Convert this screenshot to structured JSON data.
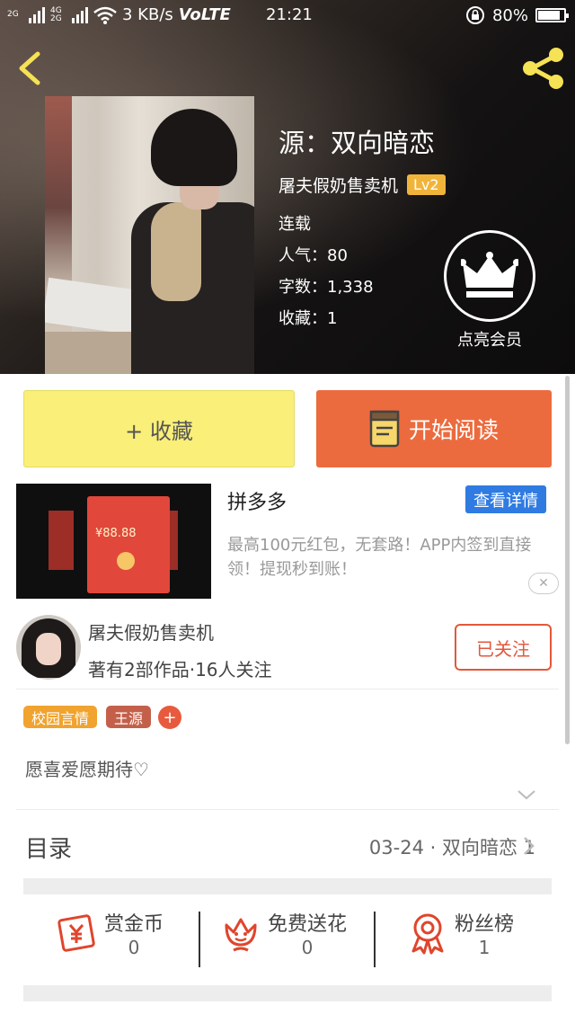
{
  "status_bar": {
    "sig1_tag": "2G",
    "sig2_tag_top": "4G",
    "sig2_tag_bottom": "2G",
    "speed": "3 KB/s",
    "volte": "VoLTE",
    "time": "21:21",
    "battery": "80%"
  },
  "header": {
    "title": "源：双向暗恋",
    "author": "屠夫假奶售卖机",
    "level": "Lv2",
    "status": "连载",
    "popularity": "人气：80",
    "word_count": "字数：1,338",
    "favorites": "收藏：1",
    "vip_label": "点亮会员"
  },
  "actions": {
    "collect": "+ 收藏",
    "read": "开始阅读"
  },
  "ad": {
    "name": "拼多多",
    "detail_button": "查看详情",
    "description": "最高100元红包，无套路！APP内签到直接领！提现秒到账！",
    "thumb_amount": "¥88.88",
    "close": "✕"
  },
  "author_card": {
    "name": "屠夫假奶售卖机",
    "stats": "著有2部作品·16人关注",
    "follow_button": "已关注"
  },
  "tags": [
    "校园言情",
    "王源"
  ],
  "tag_add": "+",
  "colors": {
    "tag_1": "#f0a32f",
    "tag_2": "#c4604a",
    "accent": "#ec6b3e",
    "collect_button": "#f9ef79",
    "ad_button": "#2f7be2"
  },
  "description": "愿喜爱愿期待♡",
  "toc": {
    "label": "目录",
    "latest": "03-24 · 双向暗恋 1"
  },
  "stats": [
    {
      "label": "赏金币",
      "value": "0",
      "icon": "red-envelope-yen-icon"
    },
    {
      "label": "免费送花",
      "value": "0",
      "icon": "flower-smile-icon"
    },
    {
      "label": "粉丝榜",
      "value": "1",
      "icon": "award-ribbon-icon"
    }
  ]
}
